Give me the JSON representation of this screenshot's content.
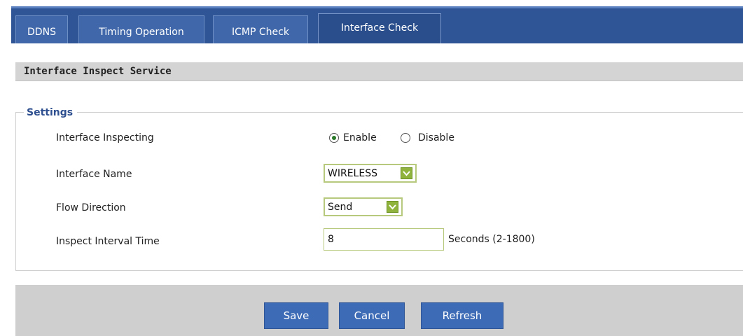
{
  "tabs": [
    {
      "label": "DDNS",
      "active": false
    },
    {
      "label": "Timing Operation",
      "active": false
    },
    {
      "label": "ICMP Check",
      "active": false
    },
    {
      "label": "Interface Check",
      "active": true
    }
  ],
  "section_title": "Interface Inspect Service",
  "settings": {
    "legend": "Settings",
    "interface_inspecting": {
      "label": "Interface Inspecting",
      "options": [
        "Enable",
        "Disable"
      ],
      "selected": "Enable"
    },
    "interface_name": {
      "label": "Interface Name",
      "value": "WIRELESS"
    },
    "flow_direction": {
      "label": "Flow Direction",
      "value": "Send"
    },
    "inspect_interval": {
      "label": "Inspect Interval Time",
      "value": "8",
      "unit": "Seconds (2-1800)"
    }
  },
  "buttons": {
    "save": "Save",
    "cancel": "Cancel",
    "refresh": "Refresh"
  },
  "colors": {
    "tab_bar": "#2f5597",
    "button": "#3e6bb5",
    "legend": "#2e4f8f",
    "select_arrow": "#8fb33c"
  }
}
